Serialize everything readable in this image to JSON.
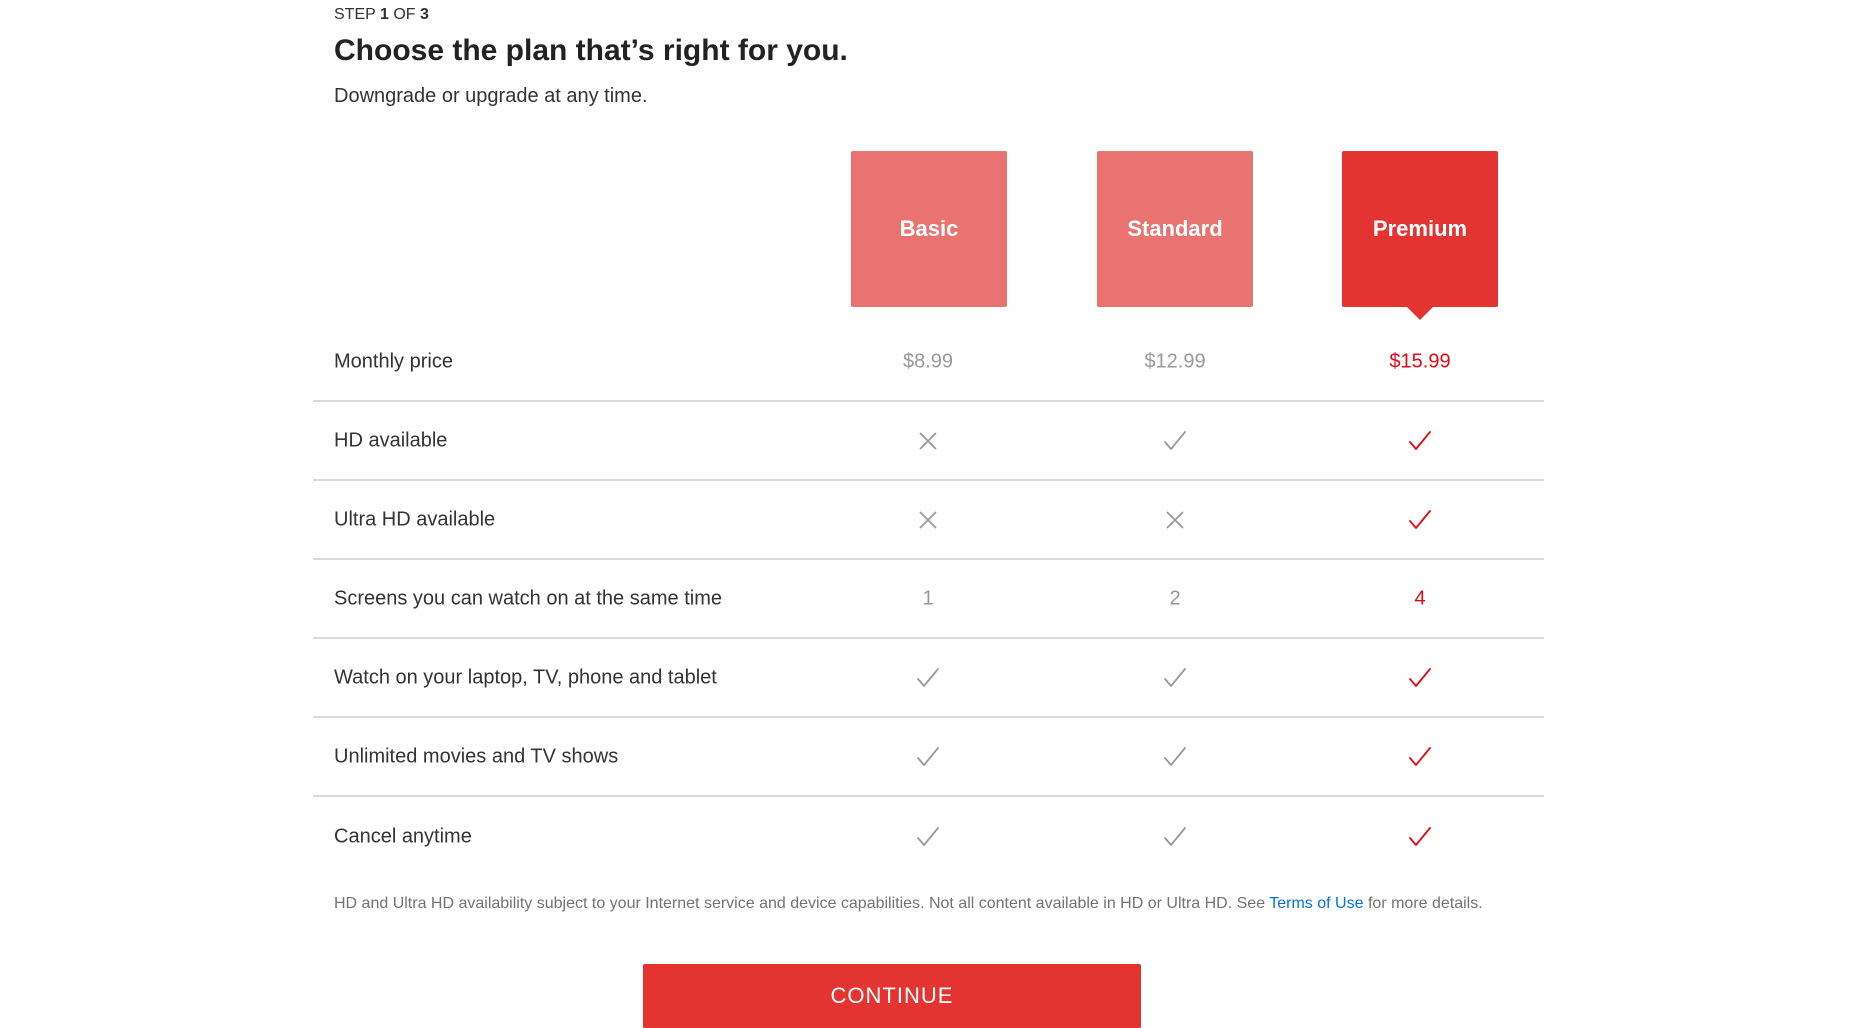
{
  "header": {
    "step_prefix": "STEP",
    "step_current": "1",
    "step_of": "OF",
    "step_total": "3",
    "title": "Choose the plan that’s right for you.",
    "subtitle": "Downgrade or upgrade at any time."
  },
  "colors": {
    "accent": "#e50914",
    "plan_unselected": "#e97370",
    "plan_selected": "#e43431",
    "muted": "#999999",
    "link": "#0071eb"
  },
  "plans": [
    {
      "name": "Basic",
      "selected": false
    },
    {
      "name": "Standard",
      "selected": false
    },
    {
      "name": "Premium",
      "selected": true
    }
  ],
  "features": [
    {
      "label": "Monthly price",
      "type": "text",
      "values": [
        "$8.99",
        "$12.99",
        "$15.99"
      ]
    },
    {
      "label": "HD available",
      "type": "icon",
      "values": [
        "x-icon",
        "check-icon",
        "check-icon"
      ]
    },
    {
      "label": "Ultra HD available",
      "type": "icon",
      "values": [
        "x-icon",
        "x-icon",
        "check-icon"
      ]
    },
    {
      "label": "Screens you can watch on at the same time",
      "type": "text",
      "values": [
        "1",
        "2",
        "4"
      ]
    },
    {
      "label": "Watch on your laptop, TV, phone and tablet",
      "type": "icon",
      "values": [
        "check-icon",
        "check-icon",
        "check-icon"
      ]
    },
    {
      "label": "Unlimited movies and TV shows",
      "type": "icon",
      "values": [
        "check-icon",
        "check-icon",
        "check-icon"
      ]
    },
    {
      "label": "Cancel anytime",
      "type": "icon",
      "values": [
        "check-icon",
        "check-icon",
        "check-icon"
      ]
    }
  ],
  "footnote": {
    "text_before": "HD and Ultra HD availability subject to your Internet service and device capabilities. Not all content available in HD or Ultra HD. See ",
    "link_text": "Terms of Use",
    "text_after": " for more details."
  },
  "continue_label": "CONTINUE"
}
